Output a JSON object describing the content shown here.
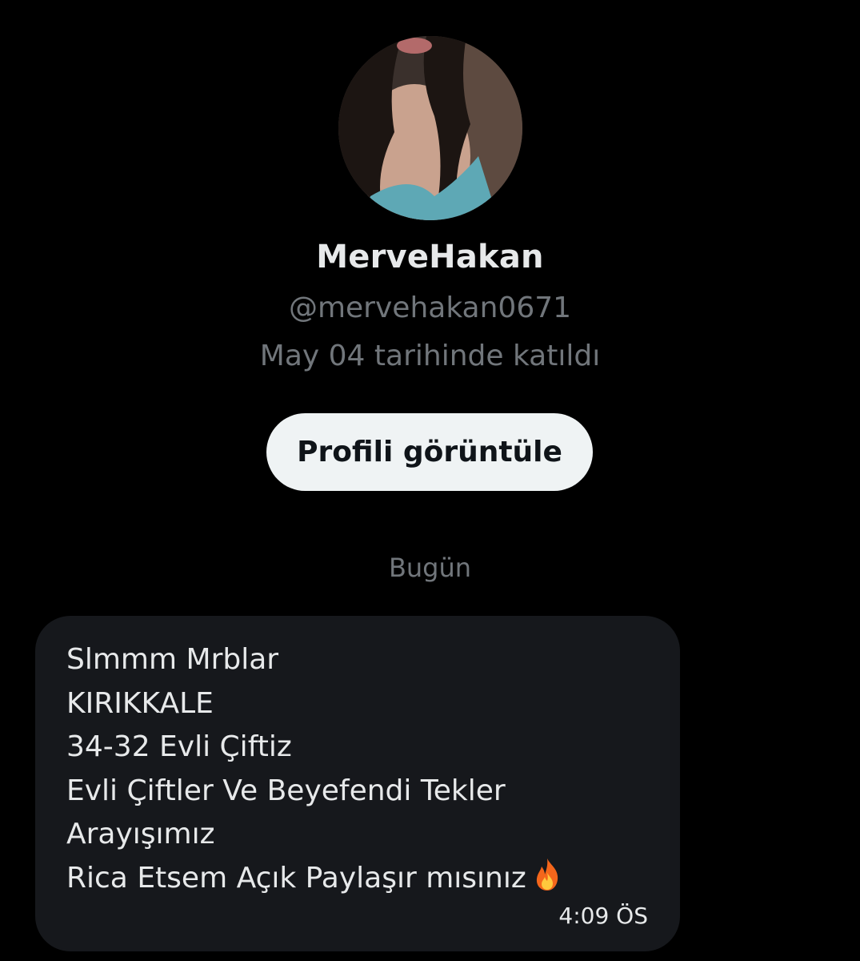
{
  "profile": {
    "display_name": "MerveHakan",
    "handle": "@mervehakan0671",
    "joined": "May 04 tarihinde katıldı",
    "view_profile_label": "Profili görüntüle"
  },
  "conversation": {
    "day_label": "Bugün",
    "messages": [
      {
        "lines": [
          "Slmmm Mrblar",
          "KIRIKKALE",
          "34-32 Evli Çiftiz",
          "Evli Çiftler Ve Beyefendi Tekler",
          "Arayışımız",
          "Rica Etsem Açık Paylaşır mısınız"
        ],
        "emoji": "fire-icon",
        "time": "4:09 ÖS"
      }
    ]
  },
  "colors": {
    "background": "#000000",
    "bubble": "#16181c",
    "primary_text": "#e7e9ea",
    "secondary_text": "#71767b",
    "button_bg": "#eff3f4",
    "button_text": "#0f1419"
  }
}
